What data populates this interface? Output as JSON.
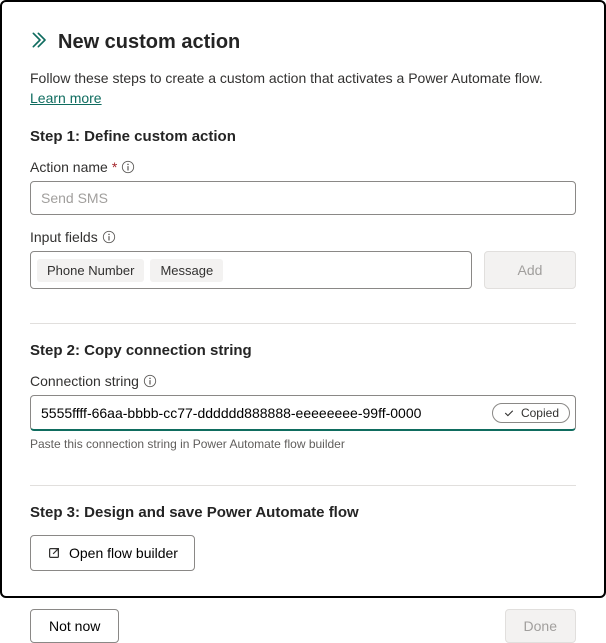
{
  "header": {
    "title": "New custom action"
  },
  "intro": {
    "text": "Follow these steps to create a custom action that activates a Power Automate flow. ",
    "linkText": "Learn more"
  },
  "step1": {
    "title": "Step 1: Define custom action",
    "actionName": {
      "label": "Action name",
      "required": "*",
      "placeholder": "Send SMS",
      "value": ""
    },
    "inputFields": {
      "label": "Input fields",
      "tags": [
        "Phone Number",
        "Message"
      ],
      "addButton": "Add"
    }
  },
  "step2": {
    "title": "Step 2: Copy connection string",
    "label": "Connection string",
    "value": "5555ffff-66aa-bbbb-cc77-dddddd888888-eeeeeeee-99ff-0000",
    "copied": "Copied",
    "helper": "Paste this connection string in Power Automate flow builder"
  },
  "step3": {
    "title": "Step 3: Design and save Power Automate flow",
    "openFlow": "Open flow builder"
  },
  "footer": {
    "notNow": "Not now",
    "done": "Done"
  }
}
